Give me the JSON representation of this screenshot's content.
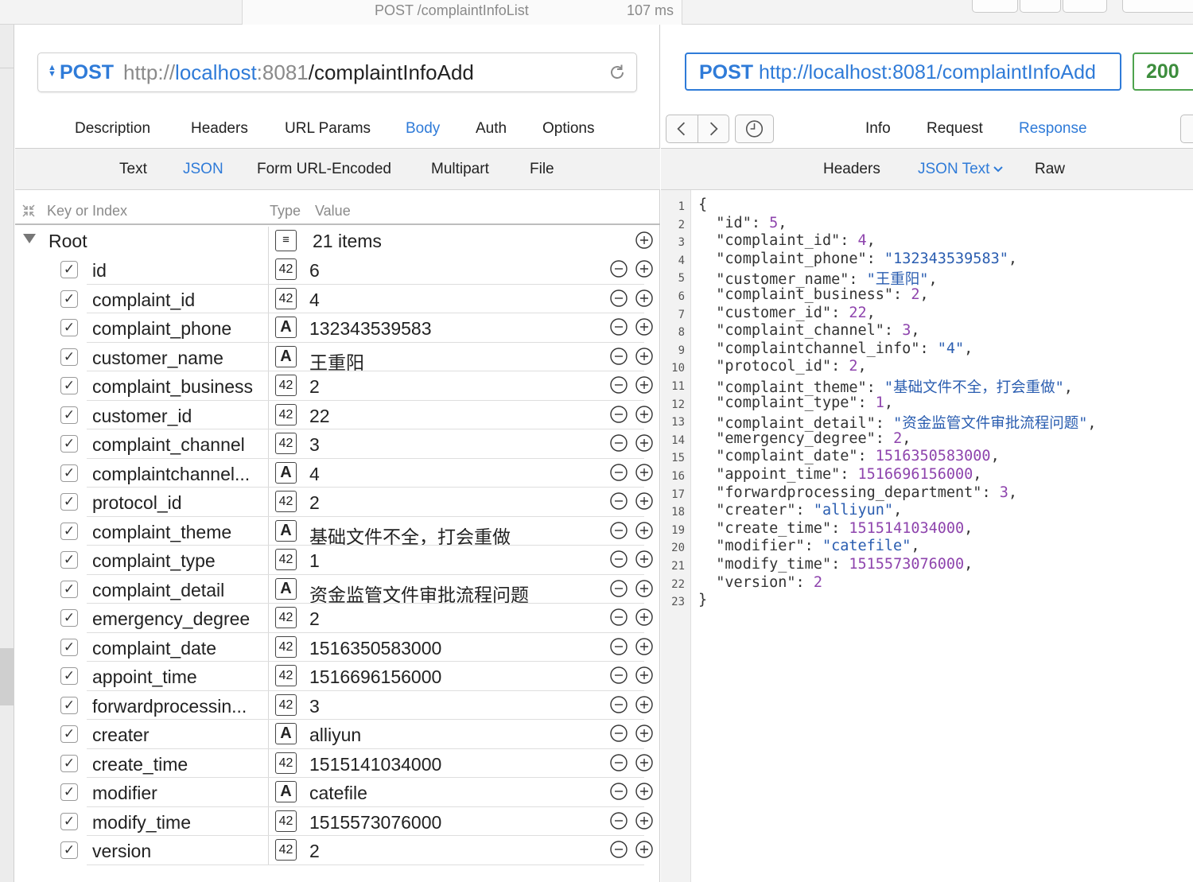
{
  "titlebar": {
    "request": "POST /complaintInfoList",
    "duration": "107 ms"
  },
  "request": {
    "method": "POST",
    "url_scheme": "http://",
    "url_host": "localhost",
    "url_port": ":8081",
    "url_path": "/complaintInfoAdd",
    "tabs": [
      "Description",
      "Headers",
      "URL Params",
      "Body",
      "Auth",
      "Options"
    ],
    "active_tab": "Body",
    "body_tabs": [
      "Text",
      "JSON",
      "Form URL-Encoded",
      "Multipart",
      "File"
    ],
    "active_body_tab": "JSON",
    "columns": {
      "key": "Key or Index",
      "type": "Type",
      "value": "Value"
    },
    "root": {
      "label": "Root",
      "count": "21 items"
    },
    "type_labels": {
      "number": "42",
      "string": "A"
    },
    "check_mark": "✓",
    "rows": [
      {
        "key": "id",
        "type": "number",
        "value": "6"
      },
      {
        "key": "complaint_id",
        "type": "number",
        "value": "4"
      },
      {
        "key": "complaint_phone",
        "type": "string",
        "value": "132343539583"
      },
      {
        "key": "customer_name",
        "type": "string",
        "value": "王重阳"
      },
      {
        "key": "complaint_business",
        "type": "number",
        "value": "2"
      },
      {
        "key": "customer_id",
        "type": "number",
        "value": "22"
      },
      {
        "key": "complaint_channel",
        "type": "number",
        "value": "3"
      },
      {
        "key": "complaintchannel...",
        "type": "string",
        "value": "4"
      },
      {
        "key": "protocol_id",
        "type": "number",
        "value": "2"
      },
      {
        "key": "complaint_theme",
        "type": "string",
        "value": "基础文件不全，打会重做"
      },
      {
        "key": "complaint_type",
        "type": "number",
        "value": "1"
      },
      {
        "key": "complaint_detail",
        "type": "string",
        "value": "资金监管文件审批流程问题"
      },
      {
        "key": "emergency_degree",
        "type": "number",
        "value": "2"
      },
      {
        "key": "complaint_date",
        "type": "number",
        "value": "1516350583000"
      },
      {
        "key": "appoint_time",
        "type": "number",
        "value": "1516696156000"
      },
      {
        "key": "forwardprocessin...",
        "type": "number",
        "value": "3"
      },
      {
        "key": "creater",
        "type": "string",
        "value": "alliyun"
      },
      {
        "key": "create_time",
        "type": "number",
        "value": "1515141034000"
      },
      {
        "key": "modifier",
        "type": "string",
        "value": "catefile"
      },
      {
        "key": "modify_time",
        "type": "number",
        "value": "1515573076000"
      },
      {
        "key": "version",
        "type": "number",
        "value": "2"
      }
    ]
  },
  "response": {
    "method": "POST",
    "url": "http://localhost:8081/complaintInfoAdd",
    "status": "200",
    "tabs": [
      "Info",
      "Request",
      "Response"
    ],
    "active_tab": "Response",
    "body_tabs": [
      "Headers",
      "JSON Text",
      "Raw"
    ],
    "active_body_tab": "JSON Text",
    "open_brace": "{",
    "close_brace": "}",
    "json_lines": [
      {
        "key": "id",
        "value": "5",
        "kind": "num"
      },
      {
        "key": "complaint_id",
        "value": "4",
        "kind": "num"
      },
      {
        "key": "complaint_phone",
        "value": "132343539583",
        "kind": "str"
      },
      {
        "key": "customer_name",
        "value": "王重阳",
        "kind": "str"
      },
      {
        "key": "complaint_business",
        "value": "2",
        "kind": "num"
      },
      {
        "key": "customer_id",
        "value": "22",
        "kind": "num"
      },
      {
        "key": "complaint_channel",
        "value": "3",
        "kind": "num"
      },
      {
        "key": "complaintchannel_info",
        "value": "4",
        "kind": "str"
      },
      {
        "key": "protocol_id",
        "value": "2",
        "kind": "num"
      },
      {
        "key": "complaint_theme",
        "value": "基础文件不全，打会重做",
        "kind": "str"
      },
      {
        "key": "complaint_type",
        "value": "1",
        "kind": "num"
      },
      {
        "key": "complaint_detail",
        "value": "资金监管文件审批流程问题",
        "kind": "str"
      },
      {
        "key": "emergency_degree",
        "value": "2",
        "kind": "num"
      },
      {
        "key": "complaint_date",
        "value": "1516350583000",
        "kind": "num"
      },
      {
        "key": "appoint_time",
        "value": "1516696156000",
        "kind": "num"
      },
      {
        "key": "forwardprocessing_department",
        "value": "3",
        "kind": "num"
      },
      {
        "key": "creater",
        "value": "alliyun",
        "kind": "str"
      },
      {
        "key": "create_time",
        "value": "1515141034000",
        "kind": "num"
      },
      {
        "key": "modifier",
        "value": "catefile",
        "kind": "str"
      },
      {
        "key": "modify_time",
        "value": "1515573076000",
        "kind": "num"
      },
      {
        "key": "version",
        "value": "2",
        "kind": "num"
      }
    ]
  },
  "colors": {
    "accent": "#2f7bd8",
    "status_ok": "#3d8d3d",
    "json_number": "#8e44ad",
    "json_string": "#2a5db0"
  }
}
